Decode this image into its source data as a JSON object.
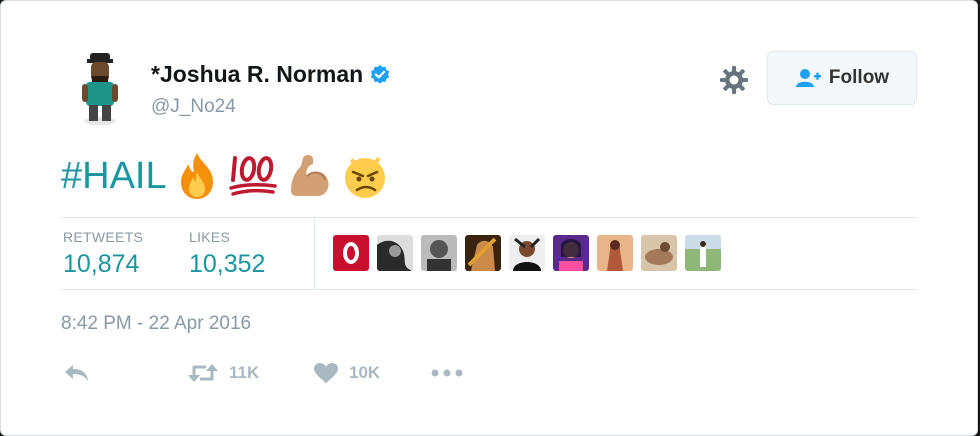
{
  "tweet": {
    "author_name": "*Joshua R. Norman",
    "author_handle": "@J_No24",
    "verified": true,
    "hashtag": "#HAIL",
    "emojis": [
      "fire-emoji",
      "hundred-points-emoji",
      "flexed-biceps-emoji",
      "angry-face-emoji"
    ],
    "timestamp": "8:42 PM - 22 Apr 2016"
  },
  "header": {
    "follow_label": "Follow",
    "settings_icon": "gear-icon"
  },
  "stats": {
    "retweets_label": "RETWEETS",
    "retweets_value": "10,874",
    "likes_label": "LIKES",
    "likes_value": "10,352"
  },
  "liker_avatars": [
    "liker-avatar-1",
    "liker-avatar-2",
    "liker-avatar-3",
    "liker-avatar-4",
    "liker-avatar-5",
    "liker-avatar-6",
    "liker-avatar-7",
    "liker-avatar-8",
    "liker-avatar-9"
  ],
  "actions": {
    "reply_icon": "reply-icon",
    "retweet_count": "11K",
    "like_count": "10K",
    "more_icon": "more-icon"
  },
  "colors": {
    "link": "#1b95a0",
    "muted": "#8899a6",
    "action_gray": "#aab8c2",
    "verified_blue": "#1da1f2"
  }
}
